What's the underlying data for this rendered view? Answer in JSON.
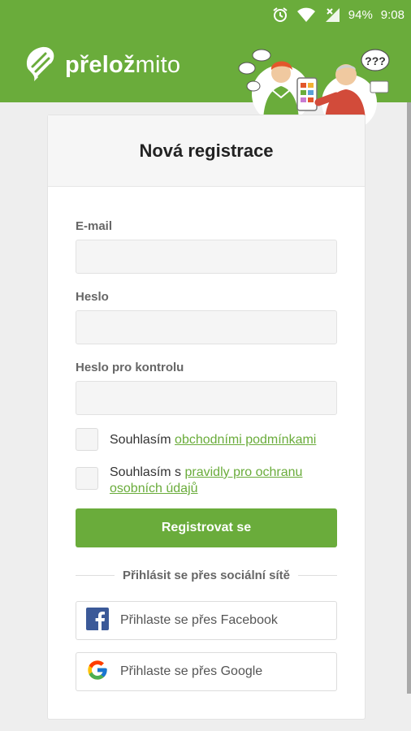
{
  "status_bar": {
    "battery": "94%",
    "time": "9:08"
  },
  "header": {
    "logo_bold": "přelož",
    "logo_light": "mito",
    "bubble_text": "???"
  },
  "form": {
    "title": "Nová registrace",
    "email_label": "E-mail",
    "email_value": "",
    "password_label": "Heslo",
    "password_value": "",
    "password_confirm_label": "Heslo pro kontrolu",
    "password_confirm_value": "",
    "terms_prefix": "Souhlasím ",
    "terms_link": "obchodními podmínkami",
    "privacy_prefix": "Souhlasím s ",
    "privacy_link": "pravidly pro ochranu osobních údajů",
    "register_button": "Registrovat se",
    "social_divider": "Přihlásit se přes sociální sítě",
    "facebook_button": "Přihlaste se přes Facebook",
    "google_button": "Přihlaste se přes Google"
  },
  "colors": {
    "brand_green": "#6aac3b",
    "facebook_blue": "#3b5998"
  },
  "icons": [
    "alarm-icon",
    "wifi-icon",
    "signal-icon",
    "battery-icon",
    "logo-icon",
    "facebook-icon",
    "google-icon"
  ]
}
